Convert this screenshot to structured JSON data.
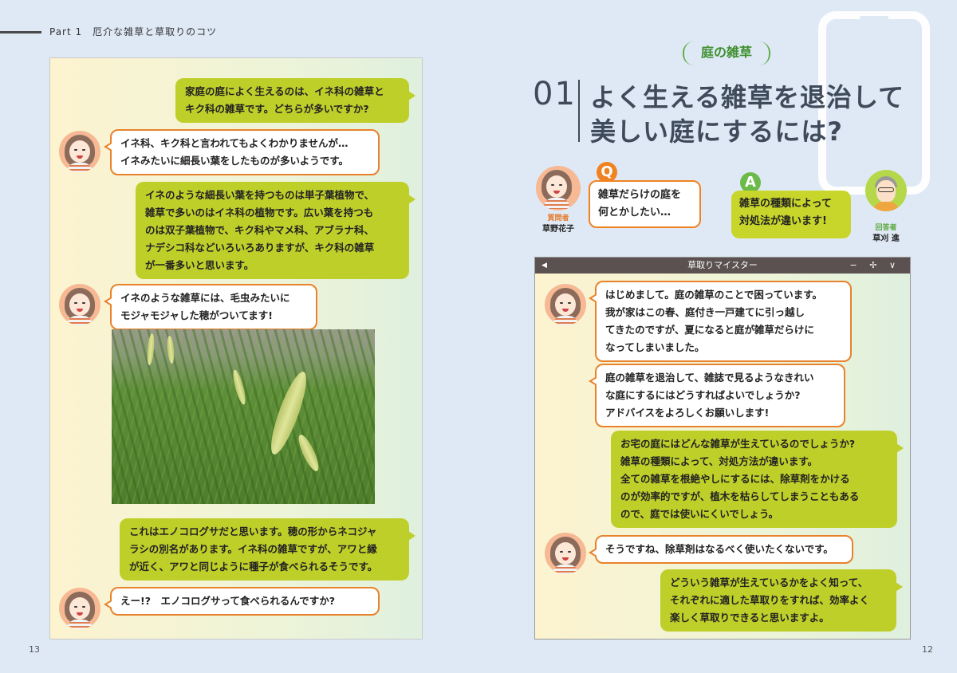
{
  "header": {
    "text": "Part 1　厄介な雑草と草取りのコツ"
  },
  "page_numbers": {
    "left": "13",
    "right": "12"
  },
  "left_chat": {
    "msg1": "家庭の庭によく生えるのは、イネ科の雑草と\nキク科の雑草です。どちらが多いですか?",
    "msg2": "イネ科、キク科と言われてもよくわかりませんが…\nイネみたいに細長い葉をしたものが多いようです。",
    "msg3": "イネのような細長い葉を持つものは単子葉植物で、\n雑草で多いのはイネ科の植物です。広い葉を持つも\nのは双子葉植物で、キク科やマメ科、アブラナ科、\nナデシコ科などいろいろありますが、キク科の雑草\nが一番多いと思います。",
    "msg4": "イネのような雑草には、毛虫みたいに\nモジャモジャした穂がついてます!",
    "msg5": "これはエノコログサだと思います。穂の形からネコジャ\nラシの別名があります。イネ科の雑草ですが、アワと縁\nが近く、アワと同じように種子が食べられるそうです。",
    "msg6": "えー!?　エノコログサって食べられるんですか?"
  },
  "right_page": {
    "section_tag": "庭の雑草",
    "title_number": "01",
    "title_line1": "よく生える雑草を退治して",
    "title_line2": "美しい庭にするには?",
    "q_badge": "Q",
    "a_badge": "A",
    "question": "雑草だらけの庭を\n何とかしたい…",
    "answer": "雑草の種類によって\n対処法が違います!",
    "questioner_role": "質問者",
    "questioner_name": "草野花子",
    "answerer_role": "回答者",
    "answerer_name": "草刈 進"
  },
  "chat_window": {
    "title": "草取りマイスター",
    "back_icon": "◀",
    "controls": "− ✢ ∨",
    "msg1": "はじめまして。庭の雑草のことで困っています。\n我が家はこの春、庭付き一戸建てに引っ越し\nてきたのですが、夏になると庭が雑草だらけに\nなってしまいました。",
    "msg2": "庭の雑草を退治して、雑誌で見るようなきれい\nな庭にするにはどうすればよいでしょうか?\nアドバイスをよろしくお願いします!",
    "msg3": "お宅の庭にはどんな雑草が生えているのでしょうか?\n雑草の種類によって、対処方法が違います。\n全ての雑草を根絶やしにするには、除草剤をかける\nのが効率的ですが、植木を枯らしてしまうこともある\nので、庭では使いにくいでしょう。",
    "msg4": "そうですね、除草剤はなるべく使いたくないです。",
    "msg5": "どういう雑草が生えているかをよく知って、\nそれぞれに適した草取りをすれば、効率よく\n楽しく草取りできると思いますよ。"
  },
  "colors": {
    "green_bubble": "#bfcf2a",
    "orange_accent": "#e9822c",
    "title": "#3f4a5a"
  }
}
